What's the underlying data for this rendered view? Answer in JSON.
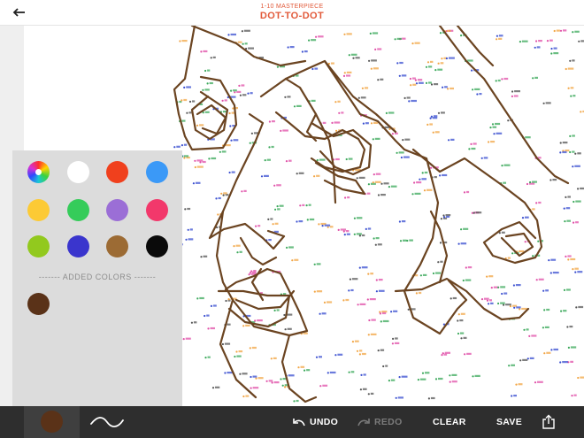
{
  "header": {
    "subtitle": "1-10 MASTERPIECE",
    "title": "DOT-TO-DOT",
    "back_icon": "arrow-left-icon"
  },
  "palette": {
    "swatches": [
      {
        "name": "color-wheel",
        "color": "wheel"
      },
      {
        "name": "white",
        "color": "#ffffff"
      },
      {
        "name": "red",
        "color": "#f0401d"
      },
      {
        "name": "blue",
        "color": "#3b99f7"
      },
      {
        "name": "yellow",
        "color": "#fcca35"
      },
      {
        "name": "green",
        "color": "#35cc5a"
      },
      {
        "name": "purple",
        "color": "#9b6ed6"
      },
      {
        "name": "pink",
        "color": "#f2386b"
      },
      {
        "name": "lime",
        "color": "#92c91e"
      },
      {
        "name": "indigo",
        "color": "#3a35cd"
      },
      {
        "name": "brown",
        "color": "#9c6b34"
      },
      {
        "name": "black",
        "color": "#0a0a0a"
      }
    ],
    "added_colors_label": "------- ADDED COLORS -------",
    "added_colors": [
      "#5a3218"
    ]
  },
  "toolbar": {
    "current_color": "#5a3218",
    "undo_label": "UNDO",
    "redo_label": "REDO",
    "clear_label": "CLEAR",
    "save_label": "SAVE",
    "share_icon": "share-icon"
  },
  "drawing": {
    "stroke_color": "#6b4421",
    "dot_colors": [
      "#3aa85a",
      "#e04fa8",
      "#f2a544",
      "#3a4fd0",
      "#555555"
    ]
  }
}
